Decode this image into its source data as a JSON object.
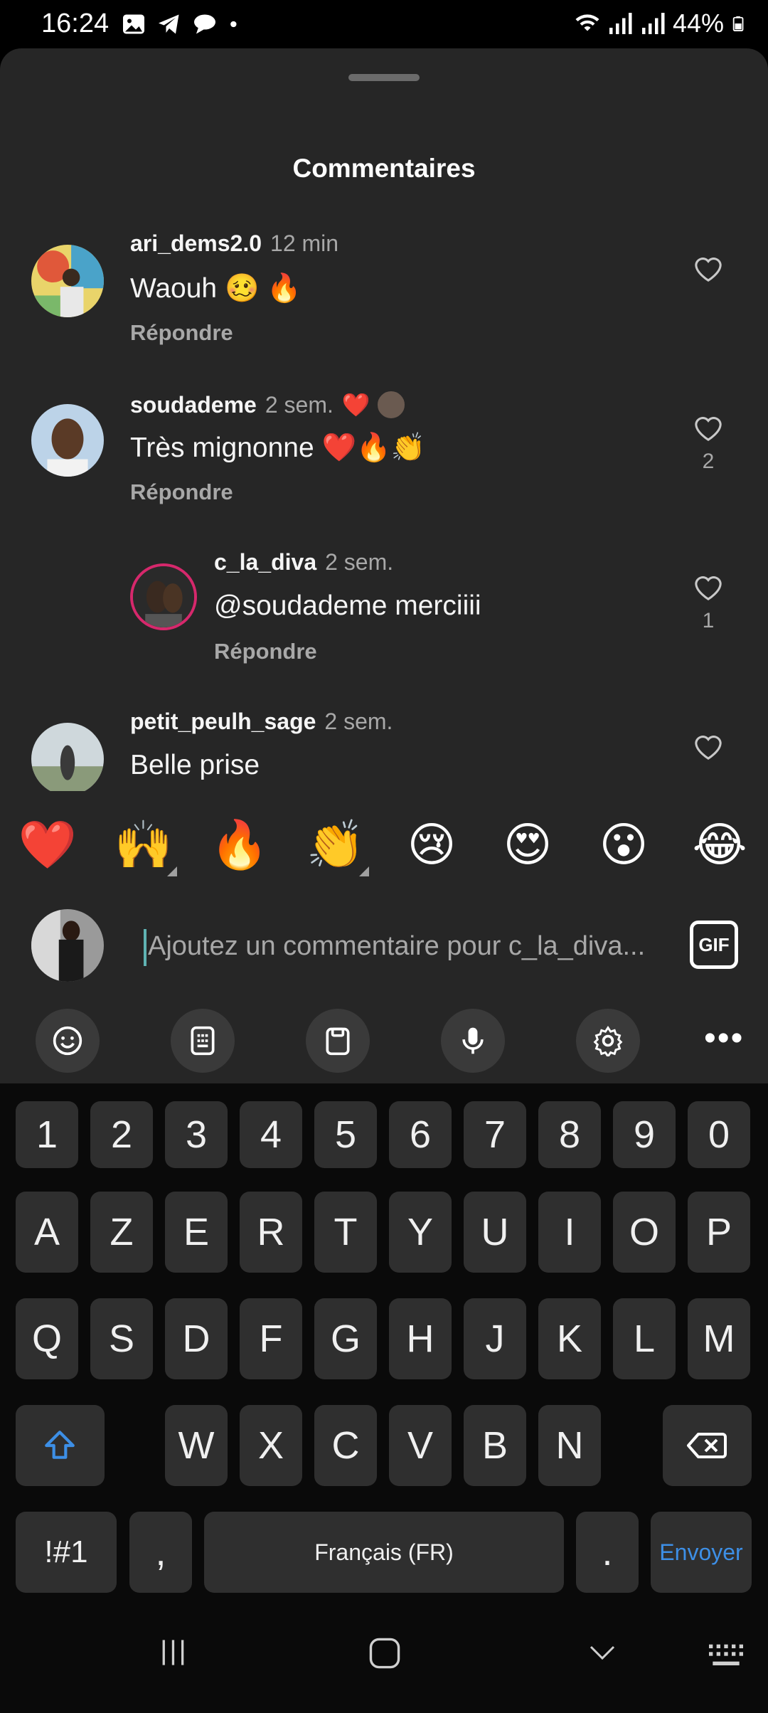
{
  "status_bar": {
    "time": "16:24",
    "battery": "44%"
  },
  "sheet": {
    "title": "Commentaires"
  },
  "comments": [
    {
      "user": "ari_dems2.0",
      "time": "12 min",
      "text": "Waouh 🥴 🔥",
      "reply_label": "Répondre",
      "likes": ""
    },
    {
      "user": "soudademe",
      "time": "2 sem.",
      "text": "Très mignonne ❤️🔥👏",
      "reply_label": "Répondre",
      "likes": "2",
      "badge": "❤️"
    },
    {
      "user": "c_la_diva",
      "time": "2 sem.",
      "text": "@soudademe merciiii",
      "reply_label": "Répondre",
      "likes": "1"
    },
    {
      "user": "petit_peulh_sage",
      "time": "2 sem.",
      "text": "Belle prise",
      "reply_label": "",
      "likes": ""
    }
  ],
  "reactions": [
    "❤️",
    "🙌",
    "🔥",
    "👏",
    "😢",
    "😍",
    "😮",
    "😂"
  ],
  "input": {
    "placeholder": "Ajoutez un commentaire pour c_la_diva...",
    "gif_label": "GIF"
  },
  "keyboard": {
    "row_numbers": [
      "1",
      "2",
      "3",
      "4",
      "5",
      "6",
      "7",
      "8",
      "9",
      "0"
    ],
    "row1": [
      "A",
      "Z",
      "E",
      "R",
      "T",
      "Y",
      "U",
      "I",
      "O",
      "P"
    ],
    "row2": [
      "Q",
      "S",
      "D",
      "F",
      "G",
      "H",
      "J",
      "K",
      "L",
      "M"
    ],
    "row3": [
      "W",
      "X",
      "C",
      "V",
      "B",
      "N"
    ],
    "symbols_label": "!#1",
    "comma_label": ",",
    "space_label": "Français (FR)",
    "period_label": ".",
    "send_label": "Envoyer"
  },
  "colors": {
    "sheet_bg": "#262626",
    "accent": "#3d8fe6",
    "muted_text": "#a8a8a8"
  }
}
